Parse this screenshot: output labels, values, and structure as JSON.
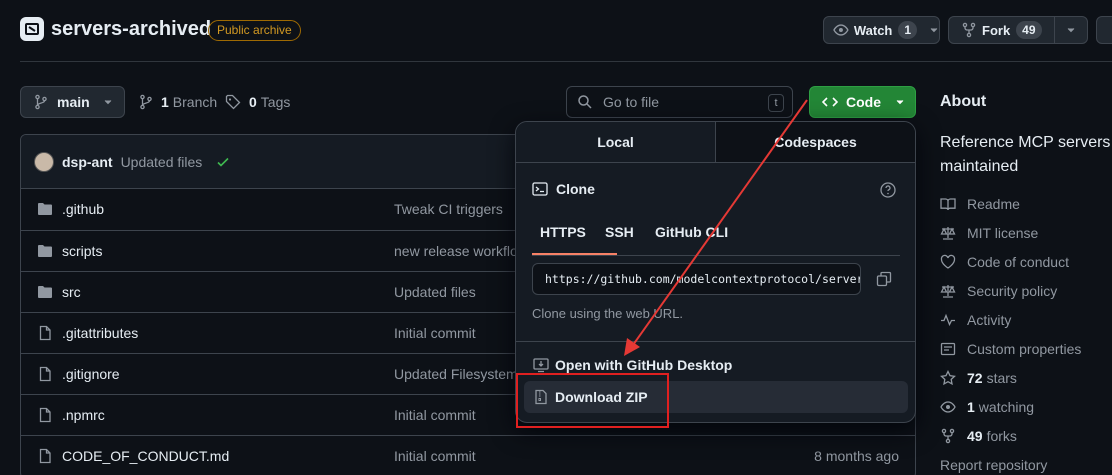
{
  "header": {
    "repo_name": "servers-archived",
    "badge": "Public archive",
    "watch_label": "Watch",
    "watch_count": "1",
    "fork_label": "Fork",
    "fork_count": "49"
  },
  "toolbar": {
    "branch": "main",
    "branch_count": "1",
    "branch_label": "Branch",
    "tag_count": "0",
    "tag_label": "Tags",
    "goto_placeholder": "Go to file",
    "goto_shortcut": "t",
    "code_label": "Code"
  },
  "commit": {
    "author": "dsp-ant",
    "message": "Updated files"
  },
  "files": [
    {
      "name": ".github",
      "type": "folder",
      "message": "Tweak CI triggers",
      "when": ""
    },
    {
      "name": "scripts",
      "type": "folder",
      "message": "new release workflo",
      "when": ""
    },
    {
      "name": "src",
      "type": "folder",
      "message": "Updated files",
      "when": ""
    },
    {
      "name": ".gitattributes",
      "type": "file",
      "message": "Initial commit",
      "when": ""
    },
    {
      "name": ".gitignore",
      "type": "file",
      "message": "Updated Filesystem",
      "when": ""
    },
    {
      "name": ".npmrc",
      "type": "file",
      "message": "Initial commit",
      "when": ""
    },
    {
      "name": "CODE_OF_CONDUCT.md",
      "type": "file",
      "message": "Initial commit",
      "when": "8 months ago"
    }
  ],
  "about": {
    "heading": "About",
    "description": "Reference MCP servers th maintained",
    "items": [
      {
        "icon": "book-icon",
        "label": "Readme",
        "count": ""
      },
      {
        "icon": "law-icon",
        "label": "MIT license",
        "count": ""
      },
      {
        "icon": "heart-icon",
        "label": "Code of conduct",
        "count": ""
      },
      {
        "icon": "law-icon",
        "label": "Security policy",
        "count": ""
      },
      {
        "icon": "pulse-icon",
        "label": "Activity",
        "count": ""
      },
      {
        "icon": "note-icon",
        "label": "Custom properties",
        "count": ""
      },
      {
        "icon": "star-icon",
        "label": "stars",
        "count": "72"
      },
      {
        "icon": "eye-icon",
        "label": "watching",
        "count": "1"
      },
      {
        "icon": "fork-icon",
        "label": "forks",
        "count": "49"
      },
      {
        "icon": "",
        "label": "Report repository",
        "count": ""
      }
    ]
  },
  "dropdown": {
    "tab_local": "Local",
    "tab_codespaces": "Codespaces",
    "clone_title": "Clone",
    "protocols": [
      "HTTPS",
      "SSH",
      "GitHub CLI"
    ],
    "url": "https://github.com/modelcontextprotocol/servers-archived.git",
    "hint": "Clone using the web URL.",
    "open_desktop": "Open with GitHub Desktop",
    "download_zip": "Download ZIP"
  },
  "colors": {
    "accent_green": "#238636",
    "link_blue": "#4493f8",
    "highlight_red": "#e02020",
    "arrow_red": "#e53935"
  }
}
